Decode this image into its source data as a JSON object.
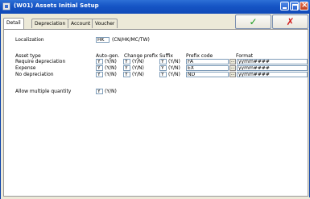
{
  "window": {
    "title": "(W01) Assets Initial Setup"
  },
  "tabs": [
    {
      "label": "Detail",
      "active": true
    },
    {
      "label": "Depreciation",
      "active": false
    },
    {
      "label": "Account",
      "active": false
    },
    {
      "label": "Voucher",
      "active": false
    }
  ],
  "toolbar": {
    "ok_symbol": "✓",
    "cancel_symbol": "✗"
  },
  "localization": {
    "label": "Localization",
    "value": "HK",
    "hint": "(CN/HK/MC/TW)"
  },
  "grid": {
    "row_header": "Asset type",
    "columns": {
      "auto_gen": "Auto-gen.",
      "change_prefix": "Change prefix",
      "suffix": "Suffix",
      "prefix_code": "Prefix code",
      "format": "Format"
    },
    "yn_hint": "(Y/N)",
    "ellipsis": "...",
    "rows": [
      {
        "label": "Require depreciation",
        "auto_gen": "Y",
        "change_prefix": "Y",
        "suffix": "Y",
        "prefix_code": "FA",
        "format": "yymm####"
      },
      {
        "label": "Expense",
        "auto_gen": "Y",
        "change_prefix": "Y",
        "suffix": "Y",
        "prefix_code": "EX",
        "format": "yymm####"
      },
      {
        "label": "No depreciation",
        "auto_gen": "Y",
        "change_prefix": "Y",
        "suffix": "Y",
        "prefix_code": "ND",
        "format": "yymm####"
      }
    ]
  },
  "multiple_quantity": {
    "label": "Allow multiple quantity",
    "value": "Y",
    "hint": "(Y/N)"
  }
}
